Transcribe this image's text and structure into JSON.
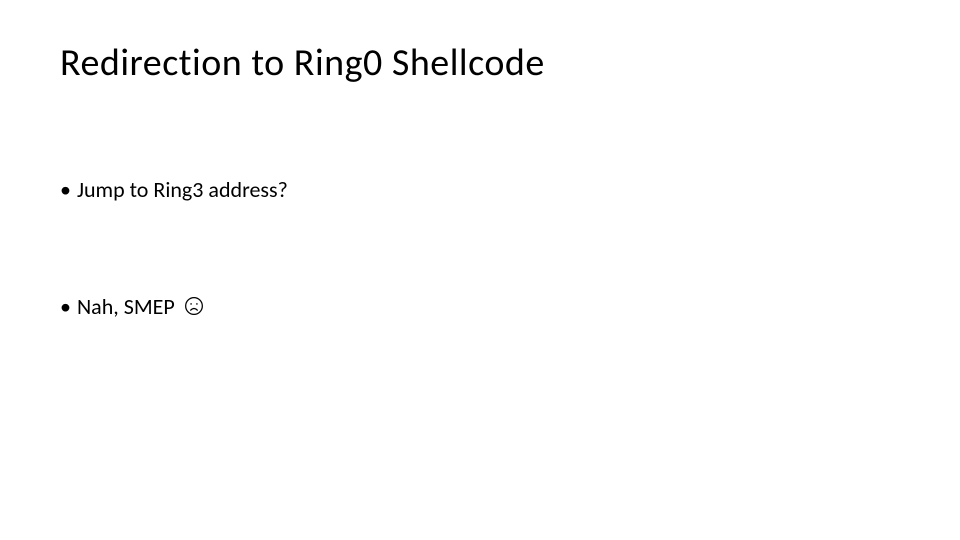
{
  "slide": {
    "title": "Redirection to Ring0 Shellcode",
    "bullets": [
      {
        "text": "Jump to Ring3 address?"
      },
      {
        "text": "Nah, SMEP",
        "hasFrown": true
      }
    ]
  }
}
